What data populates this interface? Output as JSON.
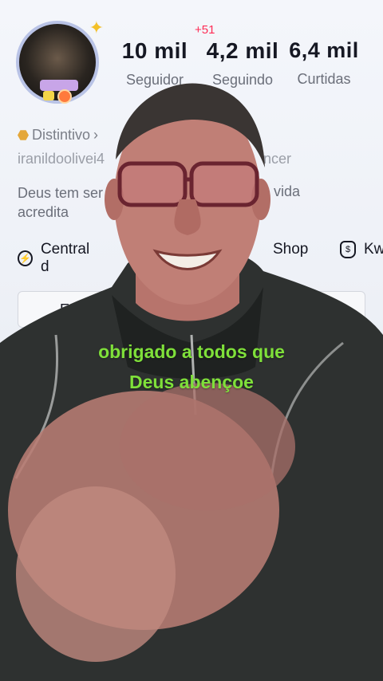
{
  "profile": {
    "stats": [
      {
        "value": "10 mil",
        "label": "Seguidor"
      },
      {
        "value": "4,2 mil",
        "label": "Seguindo"
      },
      {
        "value": "6,4 mil",
        "label": "Curtidas"
      }
    ],
    "following_new_badge": "+51",
    "badge_label": "Distintivo",
    "username_visible": "iranildoolivei4",
    "username_tail": "ncer",
    "bio_line1": "Deus tem ser",
    "bio_line1_tail": "a vida",
    "bio_line2": "acredita"
  },
  "links": {
    "central": "Central d",
    "shop": "Shop",
    "kw": "Kw"
  },
  "buttons": {
    "edit": "Edi",
    "friends": "migos"
  },
  "caption": {
    "line1": "obrigado a todos que",
    "line2": "Deus abençoe"
  },
  "colors": {
    "caption": "#7fe03a",
    "badge_red": "#fe2c55"
  }
}
